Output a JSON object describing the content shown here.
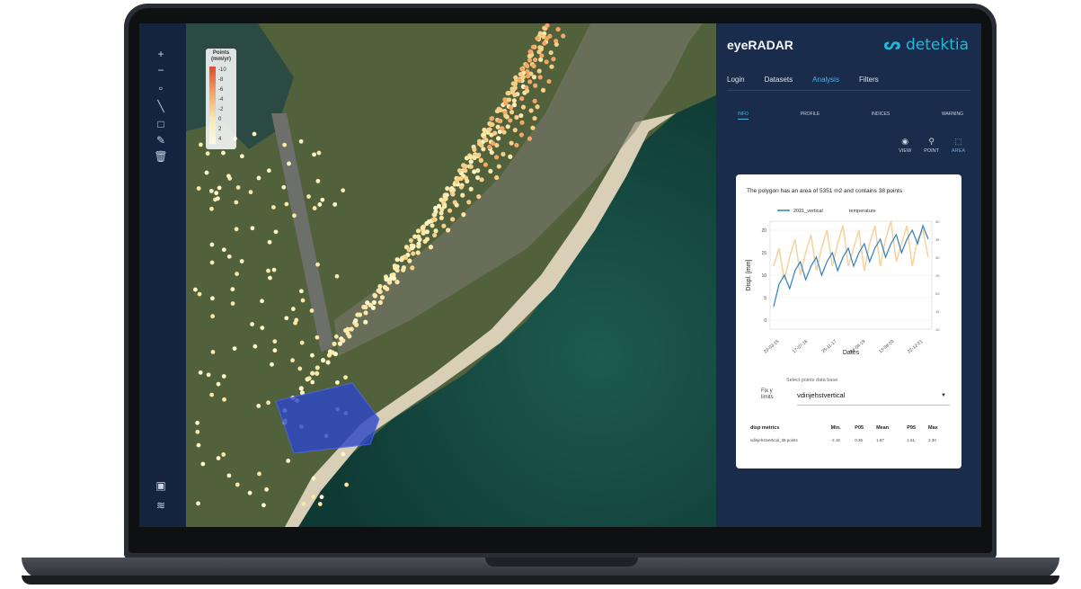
{
  "toolbar": {
    "tools": [
      "plus-icon",
      "minus-icon",
      "square-icon",
      "line-icon",
      "rectangle-icon",
      "edit-icon",
      "trash-icon"
    ],
    "bottom_tools": [
      "image-icon",
      "layers-icon"
    ]
  },
  "map": {
    "legend_title": "Points\n(mm/yr)",
    "legend_ticks": [
      "-10",
      "-8",
      "-6",
      "-4",
      "-2",
      "0",
      "2",
      "4"
    ]
  },
  "panel": {
    "app_name": "eyeRADAR",
    "logo_text": "detektia",
    "nav": [
      "Login",
      "Datasets",
      "Analysis",
      "Filters"
    ],
    "nav_active": "Analysis",
    "subtabs": [
      "INFO",
      "PROFILE",
      "INDICES",
      "WARNING"
    ],
    "subtab_active": "INFO",
    "modes": [
      {
        "label": "VIEW",
        "icon": "eye-icon"
      },
      {
        "label": "POINT",
        "icon": "pin-icon"
      },
      {
        "label": "AREA",
        "icon": "area-icon"
      }
    ],
    "mode_active": "AREA",
    "card": {
      "summary": "The polygon has an area of 5351 m2 and contains 38 points",
      "select_label": "Select points data base",
      "fix_label": "Fix y\nlimits",
      "select_value": "vdinjehstvertical",
      "metrics_header": [
        "disp metrics",
        "Min.",
        "P05",
        "Mean",
        "P95",
        "Max"
      ],
      "metrics_row": [
        "vdinjehstvertical_38 points",
        "-2.15",
        "0.35",
        "1.87",
        "1.61",
        "2.30"
      ]
    }
  },
  "chart_data": {
    "type": "line",
    "legend": [
      "2021_vertical",
      "temperature"
    ],
    "xlabel": "Dates",
    "ylabel": "Displ. [mm]",
    "x_ticks": [
      "20-03-15",
      "17-07-16",
      "25-11-17",
      "04-04-19",
      "13-08-20",
      "22-12-21"
    ],
    "y_ticks": [
      0,
      5,
      10,
      15,
      20
    ],
    "ylim": [
      -2,
      22
    ],
    "y2_ticks": [
      10,
      15,
      20,
      25,
      30,
      35,
      40
    ],
    "series": [
      {
        "name": "2021_vertical",
        "color": "#2f7fc1",
        "values": [
          3,
          8,
          10,
          7,
          11,
          13,
          9,
          12,
          14,
          10,
          13,
          15,
          11,
          14,
          16,
          12,
          15,
          17,
          13,
          16,
          18,
          14,
          17,
          19,
          15,
          18,
          20,
          17,
          21,
          18
        ]
      },
      {
        "name": "temperature",
        "color": "#f3c98a",
        "values": [
          12,
          16,
          9,
          14,
          18,
          10,
          15,
          19,
          11,
          16,
          20,
          12,
          17,
          21,
          12,
          16,
          20,
          11,
          17,
          21,
          12,
          18,
          22,
          13,
          17,
          21,
          12,
          18,
          20,
          14
        ]
      }
    ]
  }
}
